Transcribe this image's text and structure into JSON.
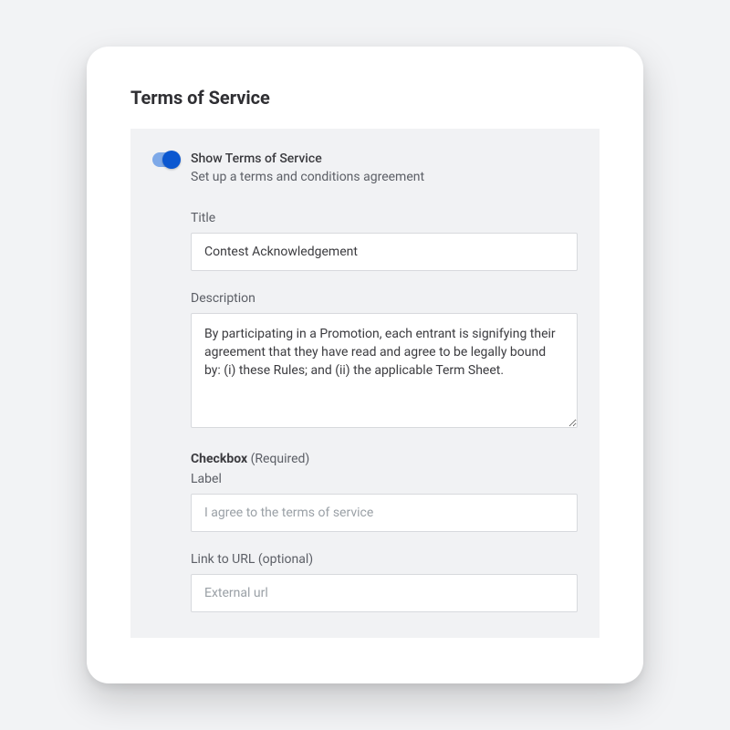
{
  "card": {
    "title": "Terms of Service"
  },
  "toggle": {
    "enabled": true,
    "label": "Show Terms of Service",
    "description": "Set up a terms and conditions agreement"
  },
  "fields": {
    "title": {
      "label": "Title",
      "value": "Contest Acknowledgement"
    },
    "description": {
      "label": "Description",
      "value": "By participating in a Promotion, each entrant is signifying their agreement that they have read and agree to be legally bound by: (i) these Rules; and (ii) the applicable Term Sheet."
    },
    "checkbox": {
      "heading_bold": "Checkbox",
      "heading_suffix": " (Required)",
      "label_label": "Label",
      "label_placeholder": "I agree to the terms of service",
      "url_label": "Link to URL (optional)",
      "url_placeholder": "External url"
    }
  }
}
